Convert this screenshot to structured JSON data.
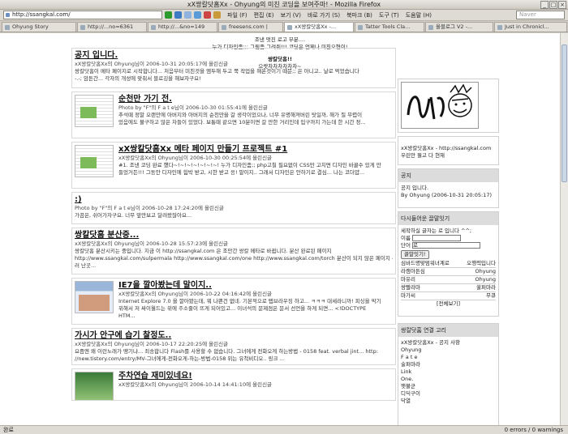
{
  "window": {
    "title": "xX쌍칼닷홈Xx - Ohyung의 미친 코딩을 보여주마! - Mozilla Firefox"
  },
  "toolbar": {
    "url": "http://ssangkal.com/",
    "menu": [
      "파일 (F)",
      "편집 (E)",
      "보기 (V)",
      "바로 가기 (S)",
      "북마크 (B)",
      "도구 (T)",
      "도움말 (H)"
    ],
    "search_placeholder": "Naver"
  },
  "tabs": [
    "Ohyung Story",
    "http://...no=6361",
    "http://...&no=149",
    "freesens.com |",
    "xX쌍칼닷홈Xx -...",
    "Tatter Tools Cla...",
    "올블로그 V2 -...",
    "Just in Chronicl..."
  ],
  "header": {
    "line1": "조낸 멋진 로고 부분....",
    "line2": "누가 디자인좀;;; 그림좀 그려줘!!! 코딩은 언제나 미친오형이!",
    "blog_title": "쌍칼닷홈!!",
    "slogan": "으랏차차차차차차~"
  },
  "posts": [
    {
      "title": "공지 입니다.",
      "meta": "xX쌍칼닷홈Xx의 Ohyung님이 2006-10-31 20:05:17에 올린신글",
      "body1": "쌍칼닷홈이 메타 페이지로 시작합니다... 처음부터 미친것을 엠두해 두고 쭉 작업을 해온것이기 때문;; 은 아니고.. 날로 먹었습니다",
      "body2": "-.-; 암튼간... 각자의 개성에 맞춰서 블로깅을 해보자구요!"
    },
    {
      "title": "순천만 가기 전.",
      "meta": "Photo by \"F\"의 F a t e님이 2006-10-30 01:55:41에 올린신글",
      "body1": "추석때 정말 오랜만에 아버지와 아버지의 순천만을 갈 생각이었으나, 너무 유명해져버린 탓일까, 해가 질 무렵이",
      "body2": "었음에도 불구하고 많은 차들이 있었다. 보통때 같으면 10분이면 갈 만한 거리인데 입구까지 가는데 한 시간 정..."
    },
    {
      "title": "xX쌍칼닷홈Xx 메타 페이지 만들기 프로젝트 #1",
      "meta": "xX쌍칼닷홈Xx의 Ohyung님이 2006-10-30 00:25:54에 올린신글",
      "body1": "#1. 조낸 코딩 완료 했다~!~!~!~!~!~!~! 누가 디자인좀;; php고칠 필요없이 CSS만 고치면 디자인 바꿀수 있게 만",
      "body2": "들었거든!!! 그동안 디자인에 힘박 받고, 시한 받고 응! 말이지.. 그래서 디자인은 안하기로 결심... 나는 코더얍..."
    },
    {
      "title": ":)",
      "meta": "Photo by \"F\"의 F a t e님이 2006-10-28 17:24:20에 올린신글",
      "body1": "가끔은, 쉬어가자구요. 너무 앞만보고 달려왔잖아요...",
      "body2": ""
    },
    {
      "title": "쌍칼닷홈 분산중...",
      "meta": "xX쌍칼닷홈Xx의 Ohyung님이 2006-10-28 15:57:23에 올린신글",
      "body1": "쌍칼닷홈 분산시키는 중입니다. 지금 이 http://ssangkal.com 은 조만간 쌍칼 메타로 바뀝니다. 분산 완료된 페이지",
      "body2": "http://www.ssangkal.com/sulpermala http://www.ssangkal.com/one http://www.ssangkal.com/torch 분산이 되지 않은 페이지 - 예",
      "body3": "러 난곳..."
    },
    {
      "title": "IE7을 깔아봤는데 말이지..",
      "meta": "xX쌍칼닷홈Xx의 Ohyung님이 2006-10-22 04:16:42에 올린신글",
      "body1": "Internet Explore 7.0 을 깔아봤는데, 뭐 나쁜건 없네. 기본적으로 탭브라우징 하고... ㅋㅋㅋ 대세라니까! 피싱을 막기",
      "body2": "위해서 저 싸이월드는 위에 주소줄이 뜨게 되어있고... 이녀석의 문제점은 문서 선언을 하게 되면... <!DOCTYPE",
      "body3": "HTM..."
    },
    {
      "title": "가시가 안구에 습기 찰정도..",
      "meta": "xX쌍칼닷홈Xx의 Ohyung님이 2006-10-17 22:20:25에 올린신글",
      "body1": "요즘엔 왜 이런노래가 땡기냐... 죄송합니다 Flash를 사용할 수 없습니다. 그녀에게 전화오게 하는방법 - 0158 feat. verbal jint... http:",
      "body2": "//new.tistory.com/entry/MV-그녀에게-전화오게-하는-방법-0158 위는 유척비디오.. 링크 ..."
    },
    {
      "title": "주차연습 재미있네요!",
      "meta": "xX쌍칼닷홈Xx의 Ohyung님이 2006-10-14 14:41:10에 올린신글",
      "body1": "",
      "body2": ""
    }
  ],
  "sidebar": {
    "profile_line1": "xX쌍칼닷홈Xx - http://ssangkal.com",
    "profile_line2": "우린만 뭘고 다 현재",
    "notice_head": "공지",
    "notice_line1": "공지 입니다.",
    "notice_line2": "By Ohyung (2006-10-31 20:05:17)",
    "guestbook_head": "다시들어운 끌말잇기",
    "gb_prompt": "세작하실 글자는 로 입니다 ^^;",
    "gb_name_label": "이름",
    "gb_word_label": "단어",
    "gb_word_value": "로",
    "gb_button": "끌말잇기!",
    "gb_entries": [
      [
        "심바드명맞멈워녀계로",
        "오행력입니다"
      ],
      [
        "라캠아튼심",
        "Ohyung"
      ],
      [
        "마유리",
        "Ohyung"
      ],
      [
        "쌍빨라마",
        "쑬퍼마라"
      ],
      [
        "마가씨",
        "무큐"
      ]
    ],
    "gb_view_all": "[전체보기]",
    "links_head": "쌍칼닷홈 연결 고리",
    "links": [
      "xX쌍칼닷홈Xx - 공지 사항",
      "Ohyung",
      "F a t e",
      "술퍼마라",
      "Link",
      "One.",
      "햇불군",
      "디딕구이",
      "닥열"
    ]
  },
  "statusbar": {
    "left": "완료",
    "right": "0 errors / 0 warnings"
  }
}
